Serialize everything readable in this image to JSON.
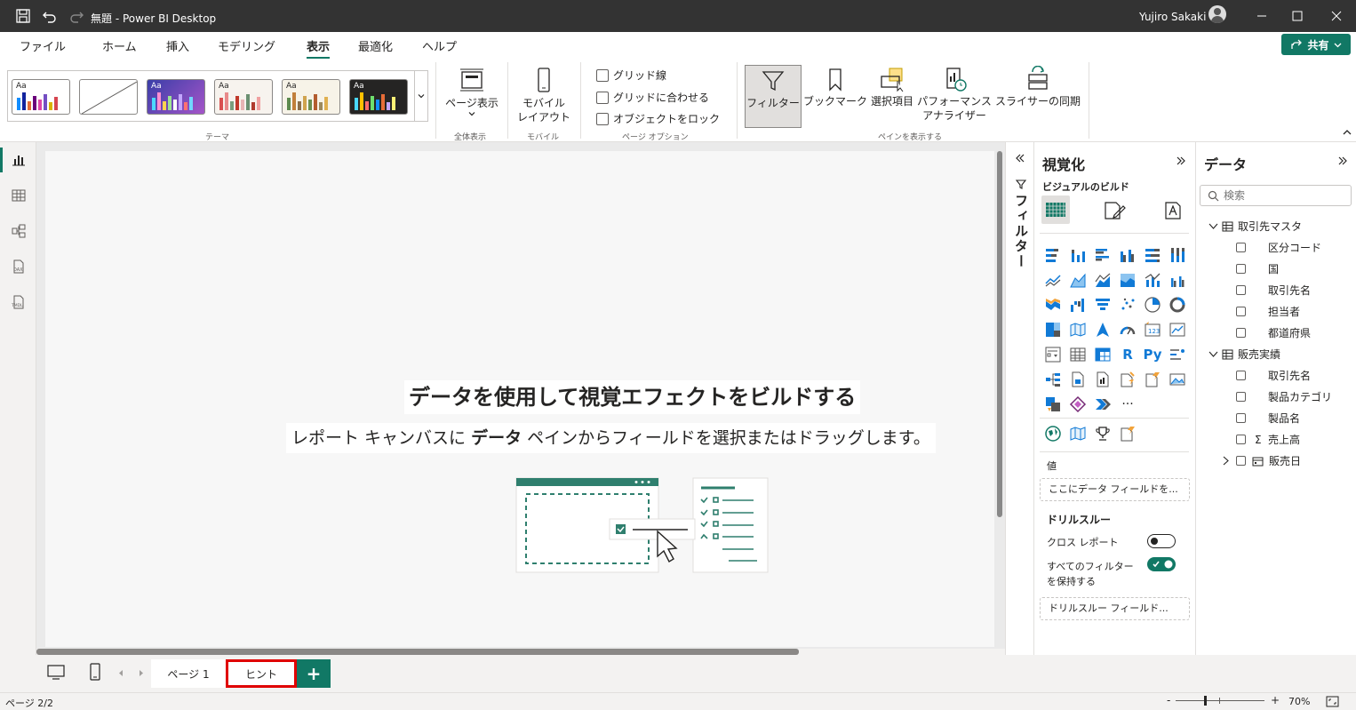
{
  "titlebar": {
    "doc": "無題",
    "sep": " - ",
    "app": "Power BI Desktop",
    "user": "Yujiro Sakaki"
  },
  "menu": {
    "tabs": [
      "ファイル",
      "ホーム",
      "挿入",
      "モデリング",
      "表示",
      "最適化",
      "ヘルプ"
    ],
    "active": "表示",
    "share": "共有"
  },
  "ribbon": {
    "theme_group": "テーマ",
    "theme_aa": "Aa",
    "page_view": {
      "line1": "ページ表示",
      "label": "全体表示"
    },
    "mobile": {
      "line1": "モバイル",
      "line2": "レイアウト",
      "label": "モバイル"
    },
    "page_options": {
      "gridlines": "グリッド線",
      "snap": "グリッドに合わせる",
      "lock": "オブジェクトをロック",
      "label": "ページ オプション"
    },
    "panes": {
      "filter": "フィルター",
      "bookmark": "ブックマーク",
      "selection": "選択項目",
      "perf1": "パフォーマンス",
      "perf2": "アナライザー",
      "sync": "スライサーの同期",
      "label": "ペインを表示する"
    }
  },
  "canvas": {
    "title": "データを使用して視覚エフェクトをビルドする",
    "sub_pre": "レポート キャンバスに ",
    "sub_bold": "データ",
    "sub_post": " ペインからフィールドを選択またはドラッグします。"
  },
  "filter_pane": {
    "label": "フィルター"
  },
  "viz_pane": {
    "title": "視覚化",
    "build": "ビジュアルのビルド",
    "values": "値",
    "values_drop": "ここにデータ フィールドを...",
    "drill": "ドリルスルー",
    "cross": "クロス レポート",
    "keep1": "すべてのフィルター",
    "keep2": "を保持する",
    "drill_drop": "ドリルスルー フィールド...",
    "r": "R",
    "py": "Py",
    "more": "···"
  },
  "data_pane": {
    "title": "データ",
    "search_placeholder": "検索",
    "tables": [
      {
        "name": "取引先マスタ",
        "fields": [
          "区分コード",
          "国",
          "取引先名",
          "担当者",
          "都道府県"
        ]
      },
      {
        "name": "販売実績",
        "fields": [
          "取引先名",
          "製品カテゴリ",
          "製品名",
          "売上高",
          "販売日"
        ]
      }
    ],
    "sigma": "Σ"
  },
  "pages": {
    "tabs": [
      "ページ 1",
      "ヒント"
    ],
    "add": "+"
  },
  "status": {
    "page": "ページ 2/2",
    "zoom": "70%",
    "minus": "-",
    "plus": "+"
  },
  "colors": {
    "accent": "#117865",
    "highlight": "#e00000"
  }
}
